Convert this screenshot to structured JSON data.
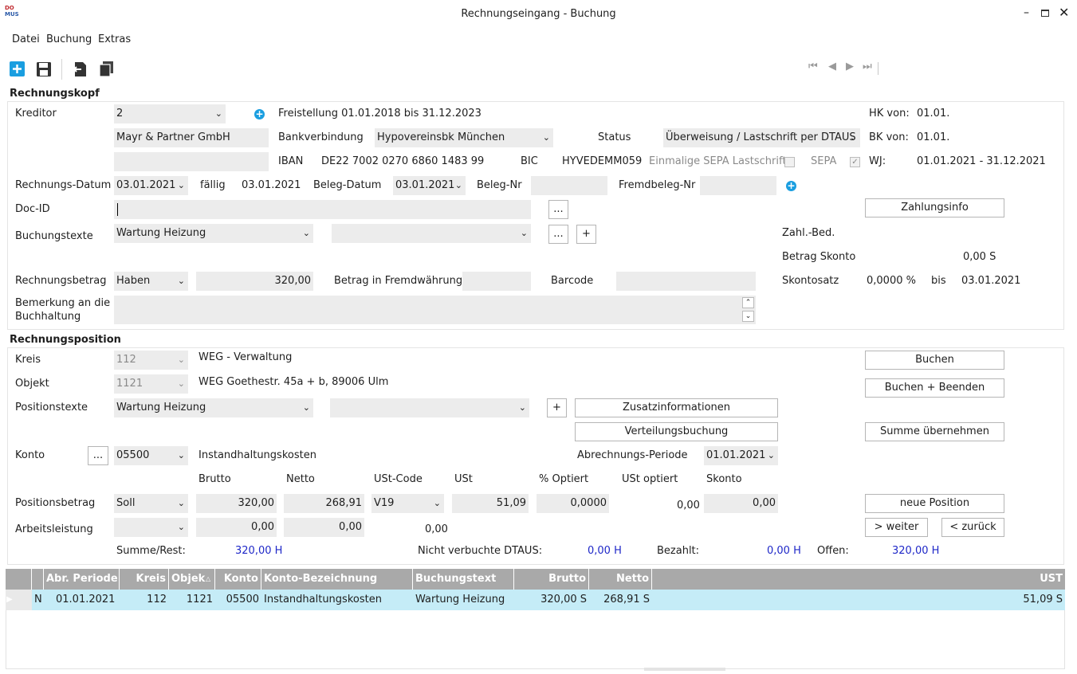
{
  "window": {
    "title": "Rechnungseingang - Buchung",
    "logo_text": "DO\nMUS"
  },
  "menu": [
    "Datei",
    "Buchung",
    "Extras"
  ],
  "toolbar": {
    "icons": [
      "new-icon",
      "save-icon",
      "exit-icon",
      "copy-icon"
    ],
    "nav_icons": [
      "first-record-icon",
      "prev-record-icon",
      "next-record-icon",
      "last-record-icon"
    ]
  },
  "kopf": {
    "section_title": "Rechnungskopf",
    "kreditor_label": "Kreditor",
    "kreditor_value": "2",
    "freistellung": "Freistellung 01.01.2018 bis 31.12.2023",
    "kreditor_name": "Mayr & Partner GmbH",
    "bankverbindung_label": "Bankverbindung",
    "bankverbindung_value": "Hypovereinsbk München",
    "status_label": "Status",
    "status_value": "Überweisung / Lastschrift per DTAUS",
    "iban_label": "IBAN",
    "iban_value": "DE22 7002 0270 6860 1483 99",
    "bic_label": "BIC",
    "bic_value": "HYVEDEMM059",
    "sepa_einmalig_label": "Einmalige SEPA Lastschrift",
    "sepa_label": "SEPA",
    "hk_label": "HK von:",
    "hk_value": "01.01.",
    "bk_label": "BK von:",
    "bk_value": "01.01.",
    "wj_label": "WJ:",
    "wj_value": "01.01.2021 - 31.12.2021",
    "rechnungsdatum_label": "Rechnungs-Datum",
    "rechnungsdatum_value": "03.01.2021",
    "faellig_label": "fällig",
    "faellig_value": "03.01.2021",
    "belegdatum_label": "Beleg-Datum",
    "belegdatum_value": "03.01.2021",
    "belegnr_label": "Beleg-Nr",
    "belegnr_value": "",
    "fremdbeleg_label": "Fremdbeleg-Nr",
    "fremdbeleg_value": "",
    "docid_label": "Doc-ID",
    "docid_value": "",
    "ellipsis": "...",
    "plus": "+",
    "zahlungsinfo_label": "Zahlungsinfo",
    "buchungstexte_label": "Buchungstexte",
    "buchungstexte_value": "Wartung Heizung",
    "buchungstexte2_value": "",
    "zahlbed_label": "Zahl.-Bed.",
    "betragskonto_label": "Betrag Skonto",
    "betragskonto_value": "0,00 S",
    "rechnungsbetrag_label": "Rechnungsbetrag",
    "sollhaben_value": "Haben",
    "rechnungsbetrag_value": "320,00",
    "fremdwaehrung_label": "Betrag in Fremdwährung",
    "barcode_label": "Barcode",
    "skontosatz_label": "Skontosatz",
    "skontosatz_value": "0,0000 %",
    "bis_label": "bis",
    "bis_value": "03.01.2021",
    "bemerkung_label_1": "Bemerkung an die",
    "bemerkung_label_2": "Buchhaltung"
  },
  "position": {
    "section_title": "Rechnungsposition",
    "kreis_label": "Kreis",
    "kreis_value": "112",
    "kreis_name": "WEG - Verwaltung",
    "objekt_label": "Objekt",
    "objekt_value": "1121",
    "objekt_name": "WEG Goethestr. 45a + b, 89006 Ulm",
    "positionstexte_label": "Positionstexte",
    "positionstexte_value": "Wartung Heizung",
    "zusatz_label": "Zusatzinformationen",
    "verteilung_label": "Verteilungsbuchung",
    "buchen_label": "Buchen",
    "buchen_beenden_label": "Buchen + Beenden",
    "summe_uebernehmen_label": "Summe übernehmen",
    "konto_label": "Konto",
    "konto_value": "05500",
    "konto_name": "Instandhaltungskosten",
    "abrperiode_label": "Abrechnungs-Periode",
    "abrperiode_value": "01.01.2021",
    "col_brutto": "Brutto",
    "col_netto": "Netto",
    "col_ustcode": "USt-Code",
    "col_ust": "USt",
    "col_optiert": "% Optiert",
    "col_ustoptiert": "USt optiert",
    "col_skonto": "Skonto",
    "positionsbetrag_label": "Positionsbetrag",
    "pos_sollhaben": "Soll",
    "pos_brutto": "320,00",
    "pos_netto": "268,91",
    "pos_ustcode": "V19",
    "pos_ust": "51,09",
    "pos_optiert": "0,0000",
    "pos_ustoptiert": "0,00",
    "pos_skonto": "0,00",
    "neue_position_label": "neue Position",
    "weiter_label": "> weiter",
    "zurueck_label": "< zurück",
    "arbeitsleistung_label": "Arbeitsleistung",
    "arb_brutto": "0,00",
    "arb_netto": "0,00",
    "arb_ust": "0,00",
    "summe_label": "Summe/Rest:",
    "summe_value": "320,00 H",
    "dtaus_label": "Nicht verbuchte DTAUS:",
    "dtaus_value": "0,00 H",
    "bezahlt_label": "Bezahlt:",
    "bezahlt_value": "0,00 H",
    "offen_label": "Offen:",
    "offen_value": "320,00 H"
  },
  "grid": {
    "headers": [
      "Abr. Periode",
      "Kreis",
      "Objek",
      "Konto",
      "Konto-Bezeichnung",
      "Buchungstext",
      "Brutto",
      "Netto",
      "UST"
    ],
    "rows": [
      {
        "flag": "N",
        "periode": "01.01.2021",
        "kreis": "112",
        "objekt": "1121",
        "konto": "05500",
        "bezeichnung": "Instandhaltungskosten",
        "text": "Wartung Heizung",
        "brutto": "320,00 S",
        "netto": "268,91 S",
        "ust": "51,09 S"
      }
    ]
  }
}
